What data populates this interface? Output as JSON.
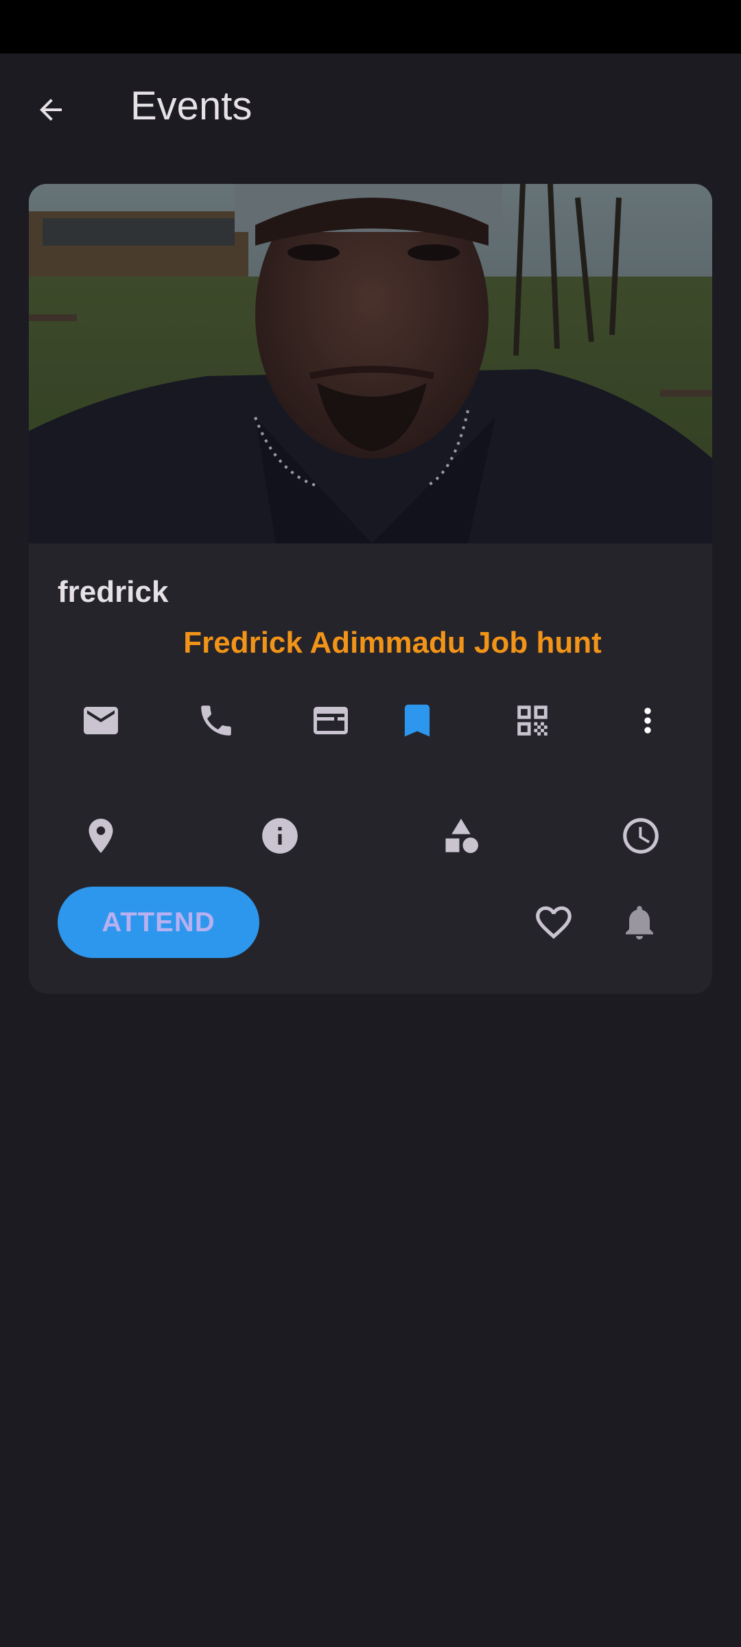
{
  "app_bar": {
    "title": "Events"
  },
  "event": {
    "owner": "fredrick",
    "title": "Fredrick Adimmadu Job hunt",
    "attend_label": "ATTEND"
  },
  "icons": {
    "row1": [
      "email-icon",
      "phone-icon",
      "web-icon",
      "bookmark-icon",
      "qr-code-icon",
      "more-vert-icon"
    ],
    "row2": [
      "location-icon",
      "info-icon",
      "category-icon",
      "clock-icon"
    ],
    "actions": [
      "heart-outline-icon",
      "bell-icon"
    ]
  },
  "colors": {
    "background": "#1c1b21",
    "card": "#25242b",
    "accent_orange": "#f29418",
    "accent_blue": "#2d97ed",
    "icon": "#cac4d0"
  }
}
